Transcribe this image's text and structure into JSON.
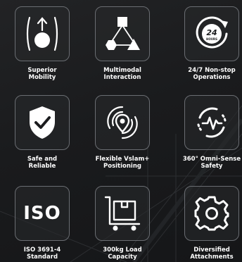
{
  "features": [
    {
      "icon": "mobility-icon",
      "line1": "Superior",
      "line2": "Mobility"
    },
    {
      "icon": "multimodal-interaction-icon",
      "line1": "Multimodal",
      "line2": "Interaction"
    },
    {
      "icon": "24-hours-clock-icon",
      "line1": "24/7 Non-stop",
      "line2": "Operations",
      "badge": "24",
      "badge_sub": "HOURS"
    },
    {
      "icon": "shield-check-icon",
      "line1": "Safe and",
      "line2": "Reliable"
    },
    {
      "icon": "location-pin-icon",
      "line1": "Flexible Vslam+",
      "line2": "Positioning"
    },
    {
      "icon": "heartbeat-sensor-icon",
      "line1": "360° Omni-Sense",
      "line2": "Safety"
    },
    {
      "icon": "iso-badge-icon",
      "line1": "ISO 3691-4",
      "line2": "Standard",
      "badge": "ISO"
    },
    {
      "icon": "cart-box-icon",
      "line1": "300kg Load",
      "line2": "Capacity"
    },
    {
      "icon": "gear-icon",
      "line1": "Diversified",
      "line2": "Attachments"
    }
  ],
  "colors": {
    "background": "#1b1c1e",
    "tile_border": "#6a6d72",
    "icon": "#ffffff",
    "text": "#ffffff"
  }
}
